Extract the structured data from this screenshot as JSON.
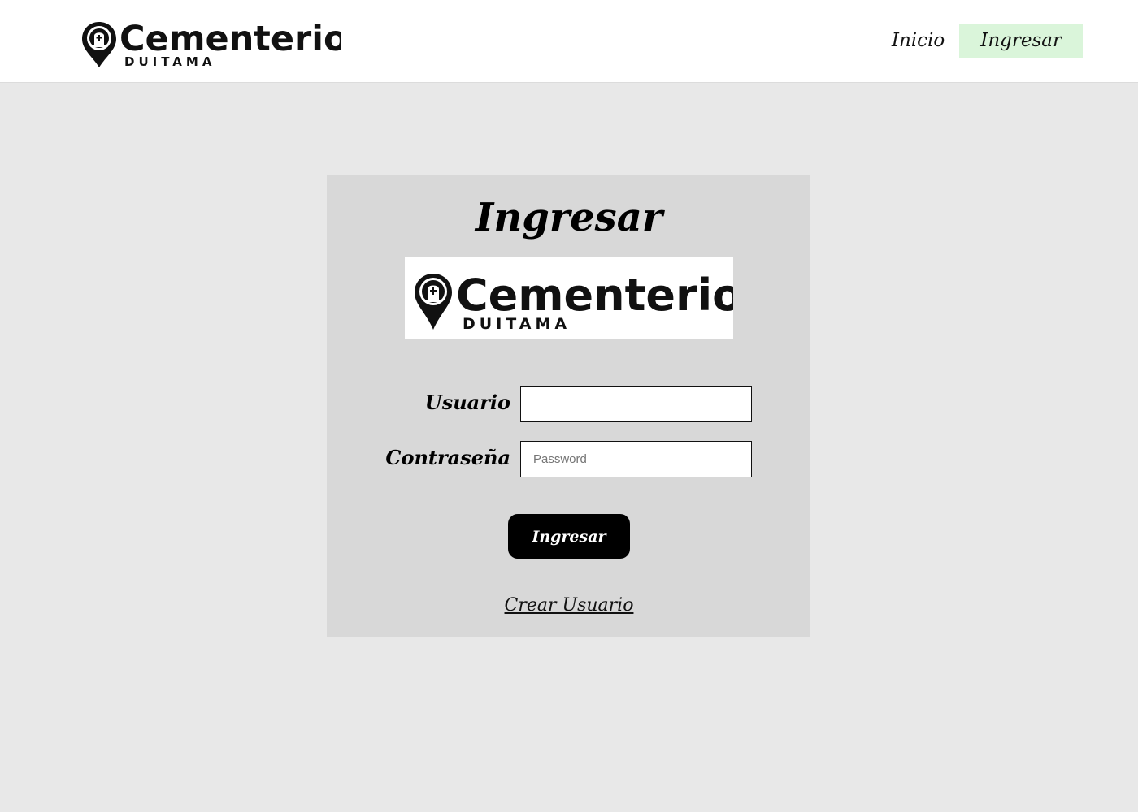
{
  "header": {
    "brand": {
      "name": "Cementerio",
      "subtitle": "DUITAMA"
    },
    "nav": [
      {
        "label": "Inicio",
        "active": false
      },
      {
        "label": "Ingresar",
        "active": true
      }
    ]
  },
  "login": {
    "title": "Ingresar",
    "logo": {
      "name": "Cementerio",
      "subtitle": "DUITAMA"
    },
    "fields": {
      "username": {
        "label": "Usuario",
        "value": "",
        "placeholder": ""
      },
      "password": {
        "label": "Contraseña",
        "value": "",
        "placeholder": "Password"
      }
    },
    "submit_label": "Ingresar",
    "create_user_link": "Crear Usuario"
  },
  "icons": {
    "logo_pin": "map-pin-with-tombstone-icon"
  },
  "colors": {
    "page_background": "#e8e8e8",
    "header_background": "#ffffff",
    "card_background": "#d8d8d8",
    "active_nav_background": "#daf5da",
    "button_background": "#000000",
    "button_text": "#ffffff"
  }
}
